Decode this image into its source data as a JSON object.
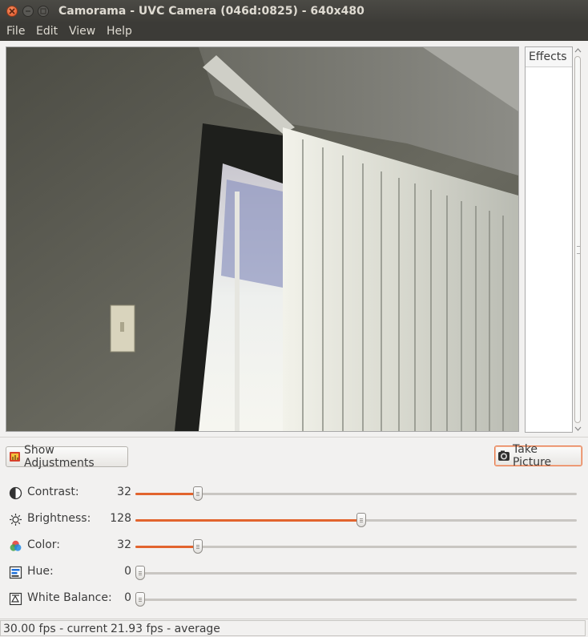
{
  "window": {
    "title": "Camorama - UVC Camera (046d:0825) - 640x480"
  },
  "menu": [
    "File",
    "Edit",
    "View",
    "Help"
  ],
  "effects": {
    "header": "Effects"
  },
  "buttons": {
    "show_adjustments": "Show Adjustments",
    "take_picture": "Take Picture"
  },
  "adjustments": [
    {
      "label": "Contrast:",
      "value": "32",
      "level": 0.13,
      "icon": "contrast-icon"
    },
    {
      "label": "Brightness:",
      "value": "128",
      "level": 0.5,
      "icon": "brightness-icon"
    },
    {
      "label": "Color:",
      "value": "32",
      "level": 0.13,
      "icon": "color-icon"
    },
    {
      "label": "Hue:",
      "value": "0",
      "level": 0.0,
      "icon": "hue-icon"
    },
    {
      "label": "White Balance:",
      "value": "0",
      "level": 0.0,
      "icon": "white-balance-icon"
    }
  ],
  "status": {
    "current": "30.00 fps - current",
    "average": "21.93 fps - average"
  },
  "colors": {
    "accent": "#e2642e",
    "titlebar": "#3c3b37"
  }
}
